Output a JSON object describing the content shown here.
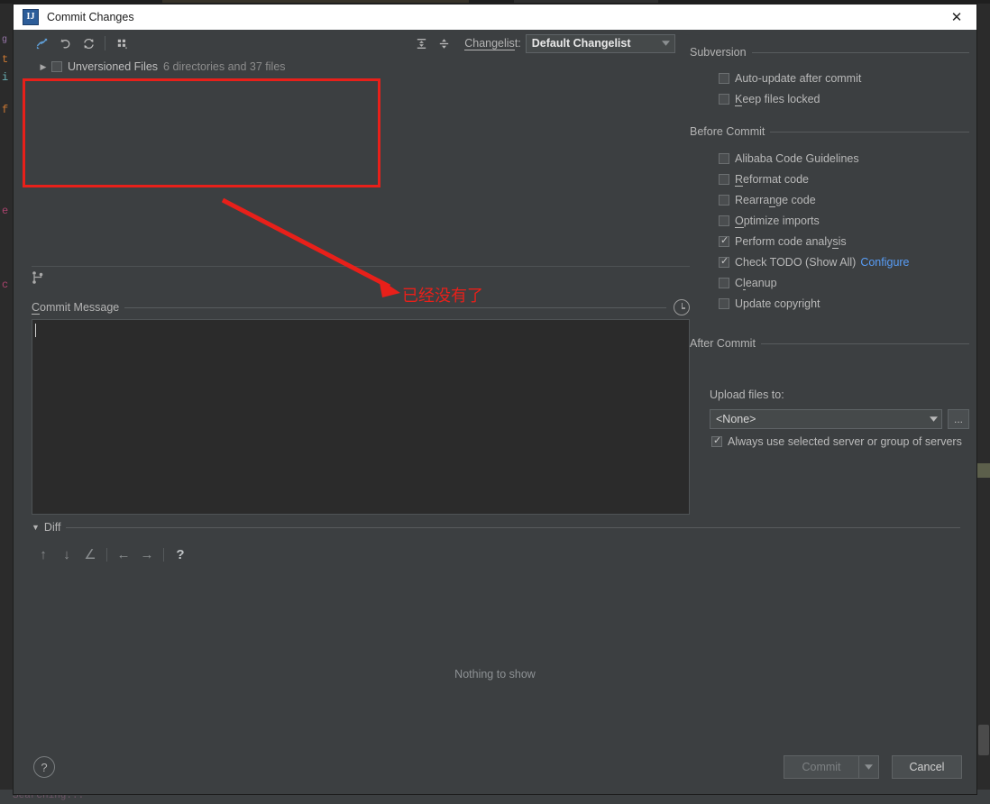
{
  "window": {
    "title": "Commit Changes",
    "icon": "intellij-idea-logo-icon",
    "close_label": "✕"
  },
  "toolbar": {
    "buttons": [
      {
        "name": "show-diff-icon",
        "glyph": "✥",
        "label": "Show Diff"
      },
      {
        "name": "rollback-icon",
        "glyph": "↺",
        "label": "Rollback"
      },
      {
        "name": "refresh-icon",
        "glyph": "⟳",
        "label": "Refresh Changes"
      },
      {
        "name": "group-by-icon",
        "glyph": "⁛",
        "label": "Group By"
      }
    ],
    "expand_all_label": "Expand All",
    "collapse_all_label": "Collapse All",
    "changelist_label": "Changelist:",
    "changelist_label_mnemonic": "Changelis",
    "changelist_label_tail": "t:",
    "changelist_value": "Default Changelist"
  },
  "file_tree": {
    "root_label": "Unversioned Files",
    "root_summary": "6 directories and 37 files",
    "root_checked": false,
    "root_expanded": false,
    "children": []
  },
  "commit_message": {
    "section_label": "Commit Message",
    "section_label_mnemonic": "C",
    "section_label_rest": "ommit Message",
    "value": "",
    "placeholder": "",
    "history_icon": "clock-icon"
  },
  "diff": {
    "section_label": "Diff",
    "expanded": true,
    "toolbar": [
      {
        "name": "previous-difference-icon",
        "glyph": "↑"
      },
      {
        "name": "next-difference-icon",
        "glyph": "↓"
      },
      {
        "name": "edit-source-icon",
        "glyph": "∠"
      },
      {
        "name": "accept-left-icon",
        "glyph": "←"
      },
      {
        "name": "accept-right-icon",
        "glyph": "→"
      },
      {
        "name": "help-icon",
        "glyph": "?"
      }
    ],
    "empty_message": "Nothing to show"
  },
  "options": {
    "subversion": {
      "title": "Subversion",
      "items": [
        {
          "label": "Auto-update after commit",
          "checked": false,
          "mnemonic": ""
        },
        {
          "label": "Keep files locked",
          "checked": false,
          "mnemonic": "K"
        }
      ]
    },
    "before_commit": {
      "title": "Before Commit",
      "items": [
        {
          "label": "Alibaba Code Guidelines",
          "checked": false,
          "mnemonic": ""
        },
        {
          "label": "Reformat code",
          "checked": false,
          "mnemonic": "R"
        },
        {
          "label": "Rearrange code",
          "checked": false,
          "mnemonic": "n"
        },
        {
          "label": "Optimize imports",
          "checked": false,
          "mnemonic": "O"
        },
        {
          "label": "Perform code analysis",
          "checked": true,
          "mnemonic": "s"
        },
        {
          "label": "Check TODO (Show All)",
          "checked": true,
          "mnemonic": "",
          "link": "Configure"
        },
        {
          "label": "Cleanup",
          "checked": false,
          "mnemonic": "l"
        },
        {
          "label": "Update copyright",
          "checked": false,
          "mnemonic": ""
        }
      ]
    },
    "after_commit": {
      "title": "After Commit",
      "upload_label": "Upload files to:",
      "upload_value": "<None>",
      "browse_label": "...",
      "always_use": {
        "label": "Always use selected server or group of servers",
        "checked": true
      }
    }
  },
  "footer": {
    "help_label": "?",
    "commit_label": "Commit",
    "commit_enabled": false,
    "commit_split_glyph": "▾",
    "cancel_label": "Cancel"
  },
  "annotations": {
    "note_text": "已经没有了",
    "highlight_color": "#e8201a"
  },
  "background_editor": {
    "left_glyphs": [
      "t",
      "i",
      "f",
      "e",
      "c"
    ],
    "status_text": "Searching..."
  }
}
